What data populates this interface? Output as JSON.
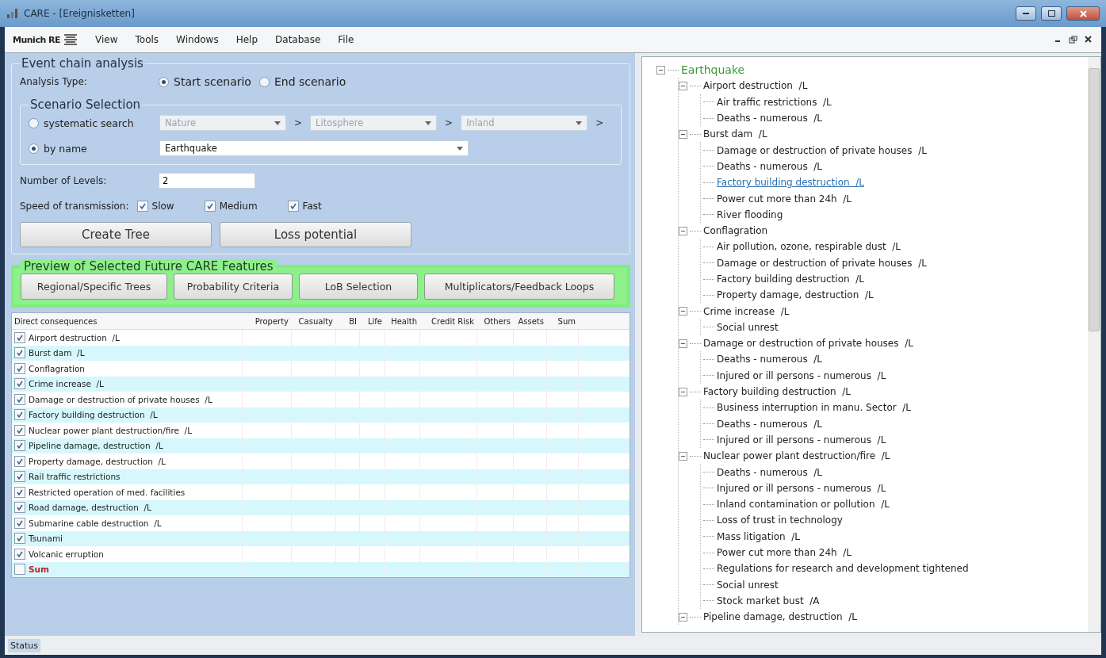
{
  "window": {
    "title": "CARE - [Ereignisketten]"
  },
  "menu": {
    "logo": "Munich RE",
    "items": [
      "View",
      "Tools",
      "Windows",
      "Help",
      "Database",
      "File"
    ]
  },
  "event_chain": {
    "title": "Event chain analysis",
    "analysis_type": {
      "label": "Analysis Type:",
      "options": [
        {
          "label": "Start scenario",
          "selected": true
        },
        {
          "label": "End scenario",
          "selected": false
        }
      ]
    },
    "scenario_selection": {
      "title": "Scenario Selection",
      "modes": [
        {
          "label": "systematic search",
          "selected": false,
          "kind": "cascade",
          "fields": [
            {
              "value": "Nature",
              "disabled": true,
              "after": ">"
            },
            {
              "value": "Litosphere",
              "disabled": true,
              "after": ">"
            },
            {
              "value": "Inland",
              "disabled": true,
              "after": ">"
            }
          ]
        },
        {
          "label": "by name",
          "selected": true,
          "kind": "dropdown",
          "value": "Earthquake"
        }
      ]
    },
    "levels": {
      "label": "Number of Levels:",
      "value": "2"
    },
    "speed": {
      "label": "Speed of transmission:",
      "options": [
        {
          "label": "Slow",
          "checked": true
        },
        {
          "label": "Medium",
          "checked": true
        },
        {
          "label": "Fast",
          "checked": true
        }
      ]
    },
    "buttons": [
      "Create Tree",
      "Loss potential"
    ]
  },
  "preview": {
    "title": "Preview of Selected Future CARE Features",
    "buttons": [
      "Regional/Specific Trees",
      "Probability Criteria",
      "LoB Selection",
      "Multiplicators/Feedback Loops"
    ]
  },
  "table": {
    "columns": [
      "Direct consequences",
      "Property",
      "Casualty",
      "BI",
      "Life",
      "Health",
      "Credit Risk",
      "Others",
      "Assets",
      "Sum"
    ],
    "rows": [
      {
        "name": "Airport destruction  /L",
        "checked": true,
        "kind": "item"
      },
      {
        "name": "Burst dam  /L",
        "checked": true,
        "kind": "item"
      },
      {
        "name": "Conflagration",
        "checked": true,
        "kind": "item"
      },
      {
        "name": "Crime increase  /L",
        "checked": true,
        "kind": "item"
      },
      {
        "name": "Damage or destruction of private houses  /L",
        "checked": true,
        "kind": "item"
      },
      {
        "name": "Factory building destruction  /L",
        "checked": true,
        "kind": "item"
      },
      {
        "name": "Nuclear power plant destruction/fire  /L",
        "checked": true,
        "kind": "item"
      },
      {
        "name": "Pipeline damage, destruction  /L",
        "checked": true,
        "kind": "item"
      },
      {
        "name": "Property damage, destruction  /L",
        "checked": true,
        "kind": "item"
      },
      {
        "name": "Rail traffic restrictions",
        "checked": true,
        "kind": "item"
      },
      {
        "name": "Restricted operation of med. facilities",
        "checked": true,
        "kind": "item"
      },
      {
        "name": "Road damage, destruction  /L",
        "checked": true,
        "kind": "item"
      },
      {
        "name": "Submarine cable destruction  /L",
        "checked": true,
        "kind": "item"
      },
      {
        "name": "Tsunami",
        "checked": true,
        "kind": "item"
      },
      {
        "name": "Volcanic erruption",
        "checked": true,
        "kind": "item"
      },
      {
        "name": "Sum",
        "checked": false,
        "kind": "sum"
      }
    ]
  },
  "tree": {
    "label": "Earthquake",
    "expanded": true,
    "highlighted": false,
    "children": [
      {
        "label": "Airport destruction  /L",
        "expanded": true,
        "highlighted": false,
        "children": [
          {
            "label": "Air traffic restrictions  /L",
            "highlighted": false
          },
          {
            "label": "Deaths - numerous  /L",
            "highlighted": false
          }
        ]
      },
      {
        "label": "Burst dam  /L",
        "expanded": true,
        "highlighted": false,
        "children": [
          {
            "label": "Damage or destruction of private houses  /L",
            "highlighted": false
          },
          {
            "label": "Deaths - numerous  /L",
            "highlighted": false
          },
          {
            "label": "Factory building destruction  /L",
            "highlighted": true
          },
          {
            "label": "Power cut more than 24h  /L",
            "highlighted": false
          },
          {
            "label": "River flooding",
            "highlighted": false
          }
        ]
      },
      {
        "label": "Conflagration",
        "expanded": true,
        "highlighted": false,
        "children": [
          {
            "label": "Air pollution, ozone, respirable dust  /L",
            "highlighted": false
          },
          {
            "label": "Damage or destruction of private houses  /L",
            "highlighted": false
          },
          {
            "label": "Factory building destruction  /L",
            "highlighted": false
          },
          {
            "label": "Property damage, destruction  /L",
            "highlighted": false
          }
        ]
      },
      {
        "label": "Crime increase  /L",
        "expanded": true,
        "highlighted": false,
        "children": [
          {
            "label": "Social unrest",
            "highlighted": false
          }
        ]
      },
      {
        "label": "Damage or destruction of private houses  /L",
        "expanded": true,
        "highlighted": false,
        "children": [
          {
            "label": "Deaths - numerous  /L",
            "highlighted": false
          },
          {
            "label": "Injured or ill persons - numerous  /L",
            "highlighted": false
          }
        ]
      },
      {
        "label": "Factory building destruction  /L",
        "expanded": true,
        "highlighted": false,
        "children": [
          {
            "label": "Business interruption in manu. Sector  /L",
            "highlighted": false
          },
          {
            "label": "Deaths - numerous  /L",
            "highlighted": false
          },
          {
            "label": "Injured or ill persons - numerous  /L",
            "highlighted": false
          }
        ]
      },
      {
        "label": "Nuclear power plant destruction/fire  /L",
        "expanded": true,
        "highlighted": false,
        "children": [
          {
            "label": "Deaths - numerous  /L",
            "highlighted": false
          },
          {
            "label": "Injured or ill persons - numerous  /L",
            "highlighted": false
          },
          {
            "label": "Inland contamination or pollution  /L",
            "highlighted": false
          },
          {
            "label": "Loss of trust in technology",
            "highlighted": false
          },
          {
            "label": "Mass litigation  /L",
            "highlighted": false
          },
          {
            "label": "Power cut more than 24h  /L",
            "highlighted": false
          },
          {
            "label": "Regulations for research and development tightened",
            "highlighted": false
          },
          {
            "label": "Social unrest",
            "highlighted": false
          },
          {
            "label": "Stock market bust  /A",
            "highlighted": false
          }
        ]
      },
      {
        "label": "Pipeline damage, destruction  /L",
        "expanded": true,
        "highlighted": false
      }
    ]
  },
  "status_bar": "Status"
}
